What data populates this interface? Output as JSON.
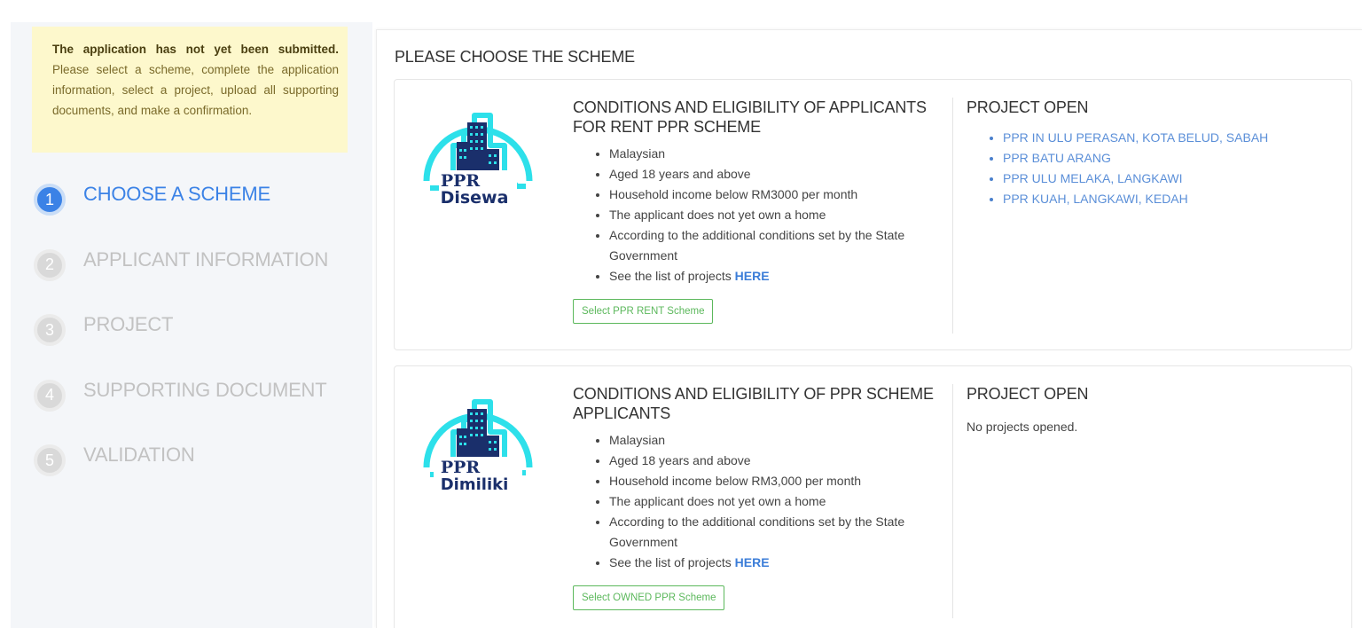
{
  "alert": {
    "bold": "The application has not yet been submitted.",
    "text": "Please select a scheme, complete the application information, select a project, upload all supporting documents, and make a confirmation."
  },
  "steps": [
    {
      "num": "1",
      "label": "CHOOSE A SCHEME"
    },
    {
      "num": "2",
      "label": "APPLICANT INFORMATION"
    },
    {
      "num": "3",
      "label": "PROJECT"
    },
    {
      "num": "4",
      "label": "SUPPORTING DOCUMENT"
    },
    {
      "num": "5",
      "label": "VALIDATION"
    }
  ],
  "main": {
    "title": "PLEASE CHOOSE THE SCHEME"
  },
  "schemes": [
    {
      "logo_top": "PPR",
      "logo_bottom": "Disewa",
      "title": "CONDITIONS AND ELIGIBILITY OF APPLICANTS FOR RENT PPR SCHEME",
      "conditions": [
        "Malaysian",
        "Aged 18 years and above",
        "Household income below RM3000 per month",
        "The applicant does not yet own a home",
        "According to the additional conditions set by the State Government"
      ],
      "see_list": "See the list of projects",
      "here": "HERE",
      "button": "Select PPR RENT Scheme",
      "projects_title": "PROJECT OPEN",
      "projects": [
        "PPR IN ULU PERASAN, KOTA BELUD, SABAH",
        "PPR BATU ARANG",
        "PPR ULU MELAKA, LANGKAWI",
        "PPR KUAH, LANGKAWI, KEDAH"
      ]
    },
    {
      "logo_top": "PPR",
      "logo_bottom": "Dimiliki",
      "title": "CONDITIONS AND ELIGIBILITY OF PPR SCHEME APPLICANTS",
      "conditions": [
        "Malaysian",
        "Aged 18 years and above",
        "Household income below RM3,000 per month",
        "The applicant does not yet own a home",
        "According to the additional conditions set by the State Government"
      ],
      "see_list": "See the list of projects",
      "here": "HERE",
      "button": "Select OWNED PPR Scheme",
      "projects_title": "PROJECT OPEN",
      "no_projects": "No projects opened."
    }
  ],
  "colors": {
    "accent": "#3b82e6",
    "alert_bg": "#fdf8cc",
    "button_green": "#5cb85c",
    "logo_cyan": "#2de0ea",
    "logo_navy": "#1a2f6b",
    "step_inactive": "#c2c2c2"
  }
}
